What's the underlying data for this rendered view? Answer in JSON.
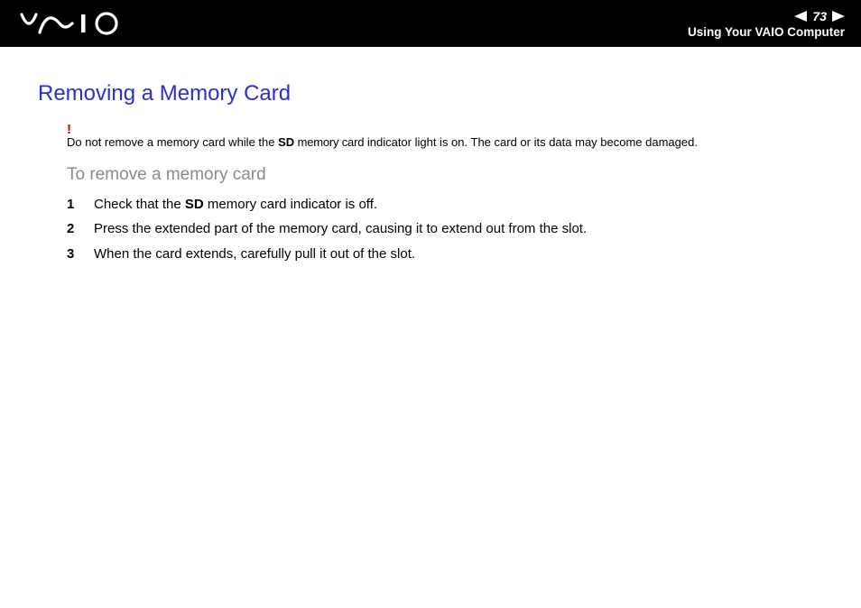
{
  "header": {
    "page_number": "73",
    "section": "Using Your VAIO Computer"
  },
  "content": {
    "title": "Removing a Memory Card",
    "warning_mark": "!",
    "warning_pre": "Do not remove a memory card while the ",
    "warning_bold": "SD",
    "warning_cond": " memory card",
    "warning_post": " indicator light is on. The card or its data may become damaged.",
    "subtitle": "To remove a memory card",
    "steps": [
      {
        "n": "1",
        "pre": "Check that the ",
        "bold": "SD",
        "post": " memory card indicator is off."
      },
      {
        "n": "2",
        "text": "Press the extended part of the memory card, causing it to extend out from the slot."
      },
      {
        "n": "3",
        "text": "When the card extends, carefully pull it out of the slot."
      }
    ]
  }
}
